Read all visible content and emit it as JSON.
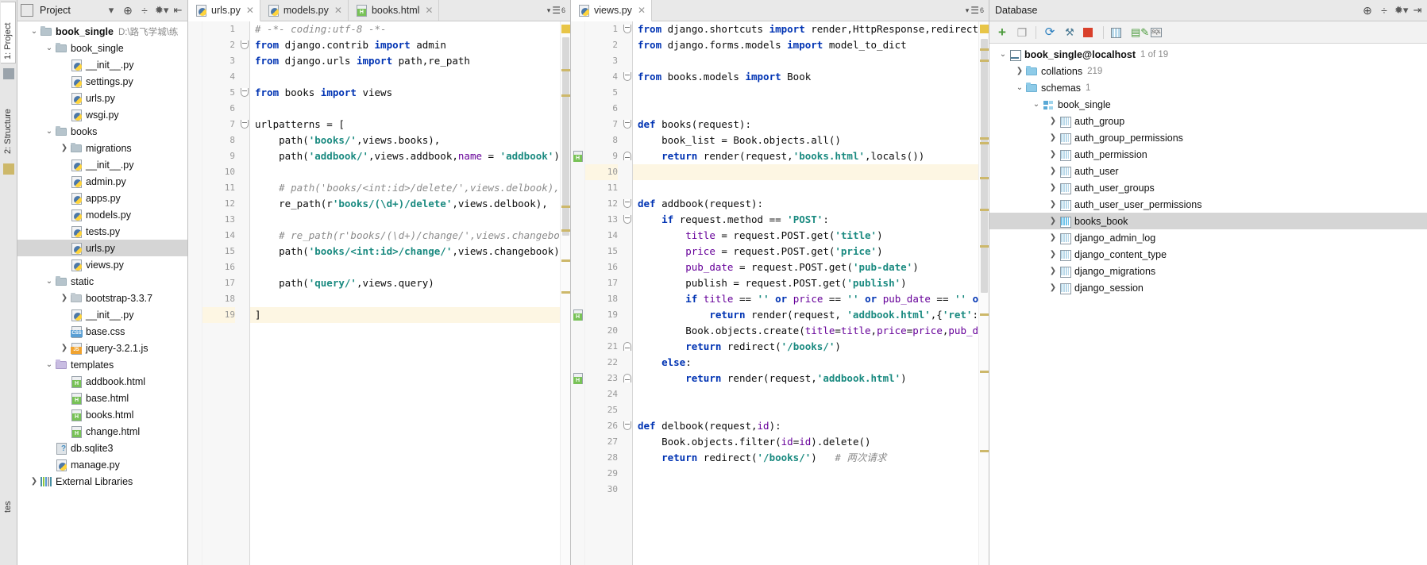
{
  "left_strip": {
    "tabs": [
      {
        "label": "1: Project",
        "name": "tool-tab-project",
        "selected": true
      },
      {
        "label": "2: Structure",
        "name": "tool-tab-structure",
        "selected": false
      }
    ]
  },
  "project_panel": {
    "title": "Project",
    "toolbar_icons": [
      "chevron-down-icon",
      "locate-icon",
      "collapse-all-icon",
      "gear-icon",
      "hide-icon"
    ],
    "tree": [
      {
        "label": "book_single",
        "sub": "D:\\路飞学城\\练",
        "icon": "folder-icon",
        "depth": 0,
        "arrow": "down",
        "bold": true,
        "selected": false
      },
      {
        "label": "book_single",
        "sub": "",
        "icon": "folder-icon",
        "depth": 1,
        "arrow": "down",
        "bold": false,
        "selected": false
      },
      {
        "label": "__init__.py",
        "sub": "",
        "icon": "python-file-icon",
        "depth": 2,
        "arrow": "none",
        "bold": false,
        "selected": false
      },
      {
        "label": "settings.py",
        "sub": "",
        "icon": "python-file-icon",
        "depth": 2,
        "arrow": "none",
        "bold": false,
        "selected": false
      },
      {
        "label": "urls.py",
        "sub": "",
        "icon": "python-file-icon",
        "depth": 2,
        "arrow": "none",
        "bold": false,
        "selected": false
      },
      {
        "label": "wsgi.py",
        "sub": "",
        "icon": "python-file-icon",
        "depth": 2,
        "arrow": "none",
        "bold": false,
        "selected": false
      },
      {
        "label": "books",
        "sub": "",
        "icon": "folder-icon",
        "depth": 1,
        "arrow": "down",
        "bold": false,
        "selected": false
      },
      {
        "label": "migrations",
        "sub": "",
        "icon": "folder-icon",
        "depth": 2,
        "arrow": "right",
        "bold": false,
        "selected": false
      },
      {
        "label": "__init__.py",
        "sub": "",
        "icon": "python-file-icon",
        "depth": 2,
        "arrow": "none",
        "bold": false,
        "selected": false
      },
      {
        "label": "admin.py",
        "sub": "",
        "icon": "python-file-icon",
        "depth": 2,
        "arrow": "none",
        "bold": false,
        "selected": false
      },
      {
        "label": "apps.py",
        "sub": "",
        "icon": "python-file-icon",
        "depth": 2,
        "arrow": "none",
        "bold": false,
        "selected": false
      },
      {
        "label": "models.py",
        "sub": "",
        "icon": "python-file-icon",
        "depth": 2,
        "arrow": "none",
        "bold": false,
        "selected": false
      },
      {
        "label": "tests.py",
        "sub": "",
        "icon": "python-file-icon",
        "depth": 2,
        "arrow": "none",
        "bold": false,
        "selected": false
      },
      {
        "label": "urls.py",
        "sub": "",
        "icon": "python-file-icon",
        "depth": 2,
        "arrow": "none",
        "bold": false,
        "selected": true
      },
      {
        "label": "views.py",
        "sub": "",
        "icon": "python-file-icon",
        "depth": 2,
        "arrow": "none",
        "bold": false,
        "selected": false
      },
      {
        "label": "static",
        "sub": "",
        "icon": "folder-icon",
        "depth": 1,
        "arrow": "down",
        "bold": false,
        "selected": false
      },
      {
        "label": "bootstrap-3.3.7",
        "sub": "",
        "icon": "folder-plain-icon",
        "depth": 2,
        "arrow": "right",
        "bold": false,
        "selected": false
      },
      {
        "label": "__init__.py",
        "sub": "",
        "icon": "python-file-icon",
        "depth": 2,
        "arrow": "none",
        "bold": false,
        "selected": false
      },
      {
        "label": "base.css",
        "sub": "",
        "icon": "css-file-icon",
        "depth": 2,
        "arrow": "none",
        "bold": false,
        "selected": false
      },
      {
        "label": "jquery-3.2.1.js",
        "sub": "",
        "icon": "js-file-icon",
        "depth": 2,
        "arrow": "right",
        "bold": false,
        "selected": false
      },
      {
        "label": "templates",
        "sub": "",
        "icon": "folder-purple-icon",
        "depth": 1,
        "arrow": "down",
        "bold": false,
        "selected": false
      },
      {
        "label": "addbook.html",
        "sub": "",
        "icon": "html-file-icon",
        "depth": 2,
        "arrow": "none",
        "bold": false,
        "selected": false
      },
      {
        "label": "base.html",
        "sub": "",
        "icon": "html-file-icon",
        "depth": 2,
        "arrow": "none",
        "bold": false,
        "selected": false
      },
      {
        "label": "books.html",
        "sub": "",
        "icon": "html-file-icon",
        "depth": 2,
        "arrow": "none",
        "bold": false,
        "selected": false
      },
      {
        "label": "change.html",
        "sub": "",
        "icon": "html-file-icon",
        "depth": 2,
        "arrow": "none",
        "bold": false,
        "selected": false
      },
      {
        "label": "db.sqlite3",
        "sub": "",
        "icon": "sqlite-file-icon",
        "depth": 1,
        "arrow": "none",
        "bold": false,
        "selected": false
      },
      {
        "label": "manage.py",
        "sub": "",
        "icon": "python-file-icon",
        "depth": 1,
        "arrow": "none",
        "bold": false,
        "selected": false
      },
      {
        "label": "External Libraries",
        "sub": "",
        "icon": "library-icon",
        "depth": 0,
        "arrow": "right",
        "bold": false,
        "selected": false
      }
    ]
  },
  "editor_left": {
    "tabs": [
      {
        "label": "urls.py",
        "icon": "python-file-icon",
        "active": true
      },
      {
        "label": "models.py",
        "icon": "python-file-icon",
        "active": false
      },
      {
        "label": "books.html",
        "icon": "html-file-icon",
        "active": false
      }
    ],
    "tab_overflow": "6",
    "lines": [
      {
        "n": "1",
        "highlight": false
      },
      {
        "n": "2",
        "highlight": false
      },
      {
        "n": "3",
        "highlight": false
      },
      {
        "n": "4",
        "highlight": false
      },
      {
        "n": "5",
        "highlight": false
      },
      {
        "n": "6",
        "highlight": false
      },
      {
        "n": "7",
        "highlight": false
      },
      {
        "n": "8",
        "highlight": false
      },
      {
        "n": "9",
        "highlight": false
      },
      {
        "n": "10",
        "highlight": false
      },
      {
        "n": "11",
        "highlight": false
      },
      {
        "n": "12",
        "highlight": false
      },
      {
        "n": "13",
        "highlight": false
      },
      {
        "n": "14",
        "highlight": false
      },
      {
        "n": "15",
        "highlight": false
      },
      {
        "n": "16",
        "highlight": false
      },
      {
        "n": "17",
        "highlight": false
      },
      {
        "n": "18",
        "highlight": false
      },
      {
        "n": "19",
        "highlight": true
      }
    ],
    "code": [
      "# -*- coding:utf-8 -*-",
      "from django.contrib import admin",
      "from django.urls import path,re_path",
      "",
      "from books import views",
      "",
      "urlpatterns = [",
      "    path('books/',views.books),",
      "    path('addbook/',views.addbook,name = 'addbook'),",
      "",
      "    # path('books/<int:id>/delete/',views.delbook),",
      "    re_path(r'books/(\\d+)/delete',views.delbook),",
      "",
      "    # re_path(r'books/(\\d+)/change/',views.changebook),",
      "    path('books/<int:id>/change/',views.changebook),",
      "",
      "    path('query/',views.query)",
      "",
      "]"
    ]
  },
  "editor_right": {
    "tabs": [
      {
        "label": "views.py",
        "icon": "python-file-icon",
        "active": true
      }
    ],
    "tab_overflow": "6",
    "lines": [
      {
        "n": "1",
        "highlight": false
      },
      {
        "n": "2",
        "highlight": false
      },
      {
        "n": "3",
        "highlight": false
      },
      {
        "n": "4",
        "highlight": false
      },
      {
        "n": "5",
        "highlight": false
      },
      {
        "n": "6",
        "highlight": false
      },
      {
        "n": "7",
        "highlight": false
      },
      {
        "n": "8",
        "highlight": false
      },
      {
        "n": "9",
        "highlight": false
      },
      {
        "n": "10",
        "highlight": true
      },
      {
        "n": "11",
        "highlight": false
      },
      {
        "n": "12",
        "highlight": false
      },
      {
        "n": "13",
        "highlight": false
      },
      {
        "n": "14",
        "highlight": false
      },
      {
        "n": "15",
        "highlight": false
      },
      {
        "n": "16",
        "highlight": false
      },
      {
        "n": "17",
        "highlight": false
      },
      {
        "n": "18",
        "highlight": false
      },
      {
        "n": "19",
        "highlight": false
      },
      {
        "n": "20",
        "highlight": false
      },
      {
        "n": "21",
        "highlight": false
      },
      {
        "n": "22",
        "highlight": false
      },
      {
        "n": "23",
        "highlight": false
      },
      {
        "n": "24",
        "highlight": false
      },
      {
        "n": "25",
        "highlight": false
      },
      {
        "n": "26",
        "highlight": false
      },
      {
        "n": "27",
        "highlight": false
      },
      {
        "n": "28",
        "highlight": false
      },
      {
        "n": "29",
        "highlight": false
      },
      {
        "n": "30",
        "highlight": false
      }
    ],
    "code": [
      "from django.shortcuts import render,HttpResponse,redirect",
      "from django.forms.models import model_to_dict",
      "",
      "from books.models import Book",
      "",
      "",
      "def books(request):",
      "    book_list = Book.objects.all()",
      "    return render(request,'books.html',locals())",
      "",
      "",
      "def addbook(request):",
      "    if request.method == 'POST':",
      "        title = request.POST.get('title')",
      "        price = request.POST.get('price')",
      "        pub_date = request.POST.get('pub-date')",
      "        publish = request.POST.get('publish')",
      "        if title == '' or price == '' or pub_date == '' or publi",
      "            return render(request, 'addbook.html',{'ret':'所有",
      "        Book.objects.create(title=title,price=price,pub_date=pub_",
      "        return redirect('/books/')",
      "    else:",
      "        return render(request,'addbook.html')",
      "",
      "",
      "def delbook(request,id):",
      "    Book.objects.filter(id=id).delete()",
      "    return redirect('/books/')   # 两次请求",
      "",
      ""
    ]
  },
  "database_panel": {
    "title": "Database",
    "header_icons": [
      "locate-icon",
      "collapse-all-icon",
      "gear-icon",
      "hide-icon"
    ],
    "toolbar_icons": [
      "add-icon",
      "copy-icon",
      "sync-icon",
      "datasource-icon",
      "stop-icon",
      "table-editor-icon",
      "run-query-icon",
      "sql-console-icon"
    ],
    "tree": [
      {
        "label": "book_single@localhost",
        "sub": "1 of 19",
        "icon": "db-connection-icon",
        "depth": 0,
        "arrow": "down",
        "bold": true,
        "selected": false
      },
      {
        "label": "collations",
        "sub": "219",
        "icon": "folder-blue-icon",
        "depth": 1,
        "arrow": "right",
        "bold": false,
        "selected": false
      },
      {
        "label": "schemas",
        "sub": "1",
        "icon": "folder-blue-icon",
        "depth": 1,
        "arrow": "down",
        "bold": false,
        "selected": false
      },
      {
        "label": "book_single",
        "sub": "",
        "icon": "schema-icon",
        "depth": 2,
        "arrow": "down",
        "bold": false,
        "selected": false
      },
      {
        "label": "auth_group",
        "sub": "",
        "icon": "table-icon",
        "depth": 3,
        "arrow": "right",
        "bold": false,
        "selected": false
      },
      {
        "label": "auth_group_permissions",
        "sub": "",
        "icon": "table-icon",
        "depth": 3,
        "arrow": "right",
        "bold": false,
        "selected": false
      },
      {
        "label": "auth_permission",
        "sub": "",
        "icon": "table-icon",
        "depth": 3,
        "arrow": "right",
        "bold": false,
        "selected": false
      },
      {
        "label": "auth_user",
        "sub": "",
        "icon": "table-icon",
        "depth": 3,
        "arrow": "right",
        "bold": false,
        "selected": false
      },
      {
        "label": "auth_user_groups",
        "sub": "",
        "icon": "table-icon",
        "depth": 3,
        "arrow": "right",
        "bold": false,
        "selected": false
      },
      {
        "label": "auth_user_user_permissions",
        "sub": "",
        "icon": "table-icon",
        "depth": 3,
        "arrow": "right",
        "bold": false,
        "selected": false
      },
      {
        "label": "books_book",
        "sub": "",
        "icon": "table-icon-highlighted",
        "depth": 3,
        "arrow": "right",
        "bold": false,
        "selected": true
      },
      {
        "label": "django_admin_log",
        "sub": "",
        "icon": "table-icon",
        "depth": 3,
        "arrow": "right",
        "bold": false,
        "selected": false
      },
      {
        "label": "django_content_type",
        "sub": "",
        "icon": "table-icon",
        "depth": 3,
        "arrow": "right",
        "bold": false,
        "selected": false
      },
      {
        "label": "django_migrations",
        "sub": "",
        "icon": "table-icon",
        "depth": 3,
        "arrow": "right",
        "bold": false,
        "selected": false
      },
      {
        "label": "django_session",
        "sub": "",
        "icon": "table-icon",
        "depth": 3,
        "arrow": "right",
        "bold": false,
        "selected": false
      }
    ]
  }
}
